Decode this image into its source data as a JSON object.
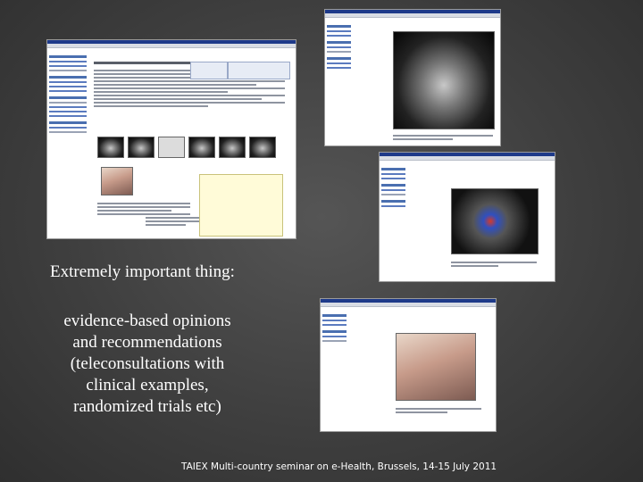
{
  "slide": {
    "intro_text": "Extremely important thing:",
    "main_lines": [
      "evidence-based opinions",
      "and recommendations"
    ],
    "sub_lines": [
      "(teleconsultations with",
      "clinical examples,",
      "randomized trials etc)"
    ],
    "footer": "TAIEX Multi-country seminar on e-Health, Brussels, 14-15 July 2011"
  },
  "screenshots": [
    {
      "name": "consultation-page",
      "content": "case text, ultrasound thumbnails, infant photo, opinion note"
    },
    {
      "name": "ultrasound-view",
      "content": "grayscale ultrasound image"
    },
    {
      "name": "doppler-view",
      "content": "colour Doppler ultrasound image"
    },
    {
      "name": "infant-photo-view",
      "content": "clinical photo of infant"
    }
  ]
}
